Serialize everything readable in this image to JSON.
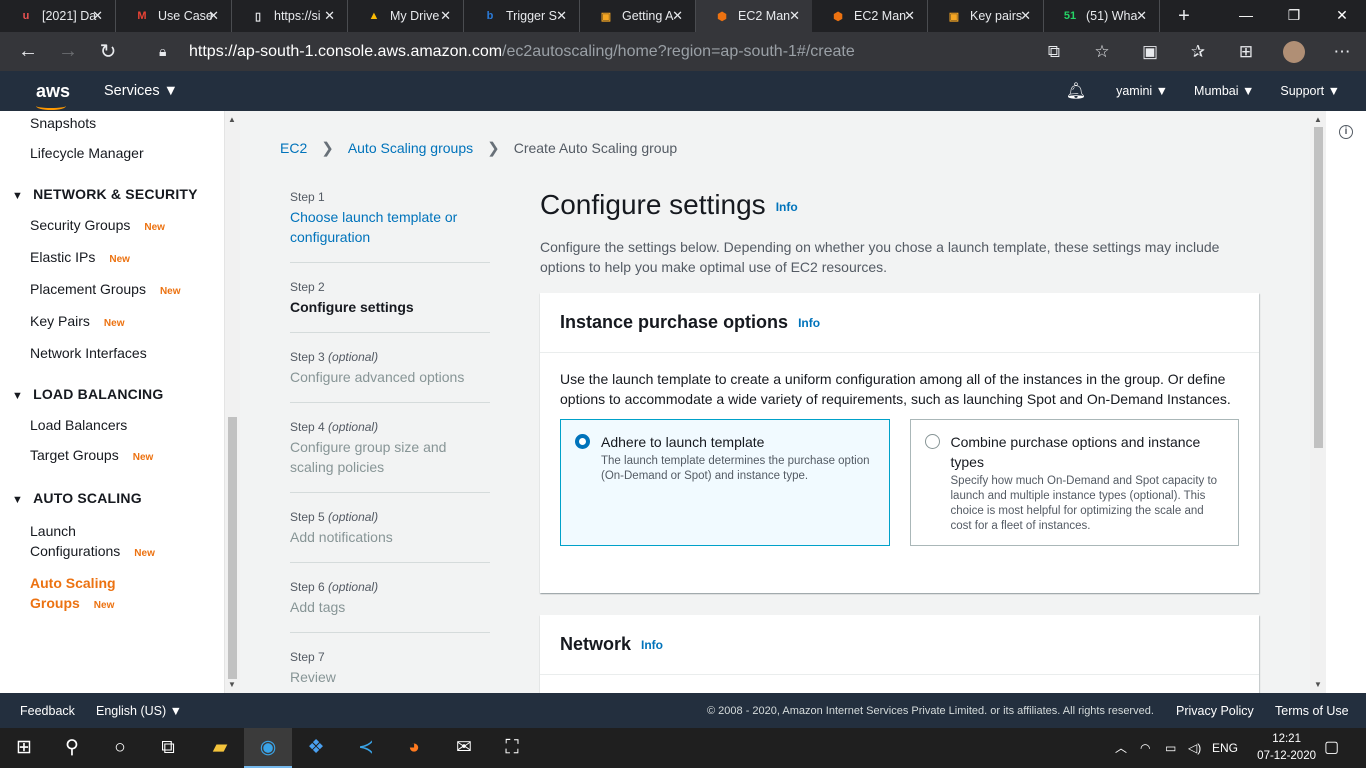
{
  "browser": {
    "tabs": [
      {
        "title": "[2021] Da",
        "icon": "udemy-icon",
        "icon_glyph": "u",
        "icon_color": "#ea5252"
      },
      {
        "title": "Use Case",
        "icon": "gmail-icon",
        "icon_glyph": "M",
        "icon_color": "#ea4335"
      },
      {
        "title": "https://si",
        "icon": "page-icon",
        "icon_glyph": "▯",
        "icon_color": "#e8eaed"
      },
      {
        "title": "My Drive",
        "icon": "drive-icon",
        "icon_glyph": "▲",
        "icon_color": "#fbbc04"
      },
      {
        "title": "Trigger S",
        "icon": "bing-icon",
        "icon_glyph": "b",
        "icon_color": "#2b7bd9"
      },
      {
        "title": "Getting A",
        "icon": "aws-box-icon",
        "icon_glyph": "▣",
        "icon_color": "#f5a623"
      },
      {
        "title": "EC2 Man",
        "icon": "ec2-icon",
        "icon_glyph": "⬢",
        "icon_color": "#ec7211"
      },
      {
        "title": "EC2 Man",
        "icon": "ec2-icon",
        "icon_glyph": "⬢",
        "icon_color": "#ec7211"
      },
      {
        "title": "Key pairs",
        "icon": "aws-box-icon",
        "icon_glyph": "▣",
        "icon_color": "#f5a623"
      },
      {
        "title": "(51) Wha",
        "icon": "whatsapp-icon",
        "icon_glyph": "51",
        "icon_color": "#25d366"
      }
    ],
    "active_tab_index": 6,
    "url_host": "https://ap-south-1.console.aws.amazon.com",
    "url_path": "/ec2autoscaling/home?region=ap-south-1#/create"
  },
  "aws_nav": {
    "logo": "aws",
    "services": "Services ▼",
    "user": "yamini ▼",
    "region": "Mumbai ▼",
    "support": "Support ▼"
  },
  "sidebar": {
    "items_top": [
      "Snapshots",
      "Lifecycle Manager"
    ],
    "sections": [
      {
        "title": "NETWORK & SECURITY",
        "items": [
          {
            "label": "Security Groups",
            "badge": "New"
          },
          {
            "label": "Elastic IPs",
            "badge": "New"
          },
          {
            "label": "Placement Groups",
            "badge": "New"
          },
          {
            "label": "Key Pairs",
            "badge": "New"
          },
          {
            "label": "Network Interfaces",
            "badge": ""
          }
        ]
      },
      {
        "title": "LOAD BALANCING",
        "items": [
          {
            "label": "Load Balancers",
            "badge": ""
          },
          {
            "label": "Target Groups",
            "badge": "New"
          }
        ]
      },
      {
        "title": "AUTO SCALING",
        "items": [
          {
            "label_line1": "Launch",
            "label_line2": "Configurations",
            "badge": "New"
          },
          {
            "label_line1": "Auto Scaling",
            "label_line2": "Groups",
            "badge": "New"
          }
        ]
      }
    ]
  },
  "breadcrumb": {
    "items": [
      "EC2",
      "Auto Scaling groups",
      "Create Auto Scaling group"
    ]
  },
  "steps": [
    {
      "num": "Step 1",
      "opt": "",
      "title": "Choose launch template or configuration"
    },
    {
      "num": "Step 2",
      "opt": "",
      "title": "Configure settings"
    },
    {
      "num": "Step 3",
      "opt": "(optional)",
      "title": "Configure advanced options"
    },
    {
      "num": "Step 4",
      "opt": "(optional)",
      "title": "Configure group size and scaling policies"
    },
    {
      "num": "Step 5",
      "opt": "(optional)",
      "title": "Add notifications"
    },
    {
      "num": "Step 6",
      "opt": "(optional)",
      "title": "Add tags"
    },
    {
      "num": "Step 7",
      "opt": "",
      "title": "Review"
    }
  ],
  "page": {
    "title": "Configure settings",
    "info": "Info",
    "description": "Configure the settings below. Depending on whether you chose a launch template, these settings may include options to help you make optimal use of EC2 resources."
  },
  "purchase": {
    "title": "Instance purchase options",
    "info": "Info",
    "description": "Use the launch template to create a uniform configuration among all of the instances in the group. Or define options to accommodate a wide variety of requirements, such as launching Spot and On-Demand Instances.",
    "option1_title": "Adhere to launch template",
    "option1_desc": "The launch template determines the purchase option (On-Demand or Spot) and instance type.",
    "option2_title": "Combine purchase options and instance types",
    "option2_desc": "Specify how much On-Demand and Spot capacity to launch and multiple instance types (optional). This choice is most helpful for optimizing the scale and cost for a fleet of instances.",
    "selected": "option1"
  },
  "network": {
    "title": "Network",
    "info": "Info"
  },
  "footer": {
    "feedback": "Feedback",
    "language": "English (US) ▼",
    "copyright": "© 2008 - 2020, Amazon Internet Services Private Limited. or its affiliates. All rights reserved.",
    "privacy": "Privacy Policy",
    "terms": "Terms of Use"
  },
  "taskbar": {
    "lang": "ENG",
    "time": "12:21",
    "date": "07-12-2020"
  },
  "colors": {
    "aws_nav": "#232f3e",
    "accent": "#ec7211",
    "link": "#0073bb"
  }
}
